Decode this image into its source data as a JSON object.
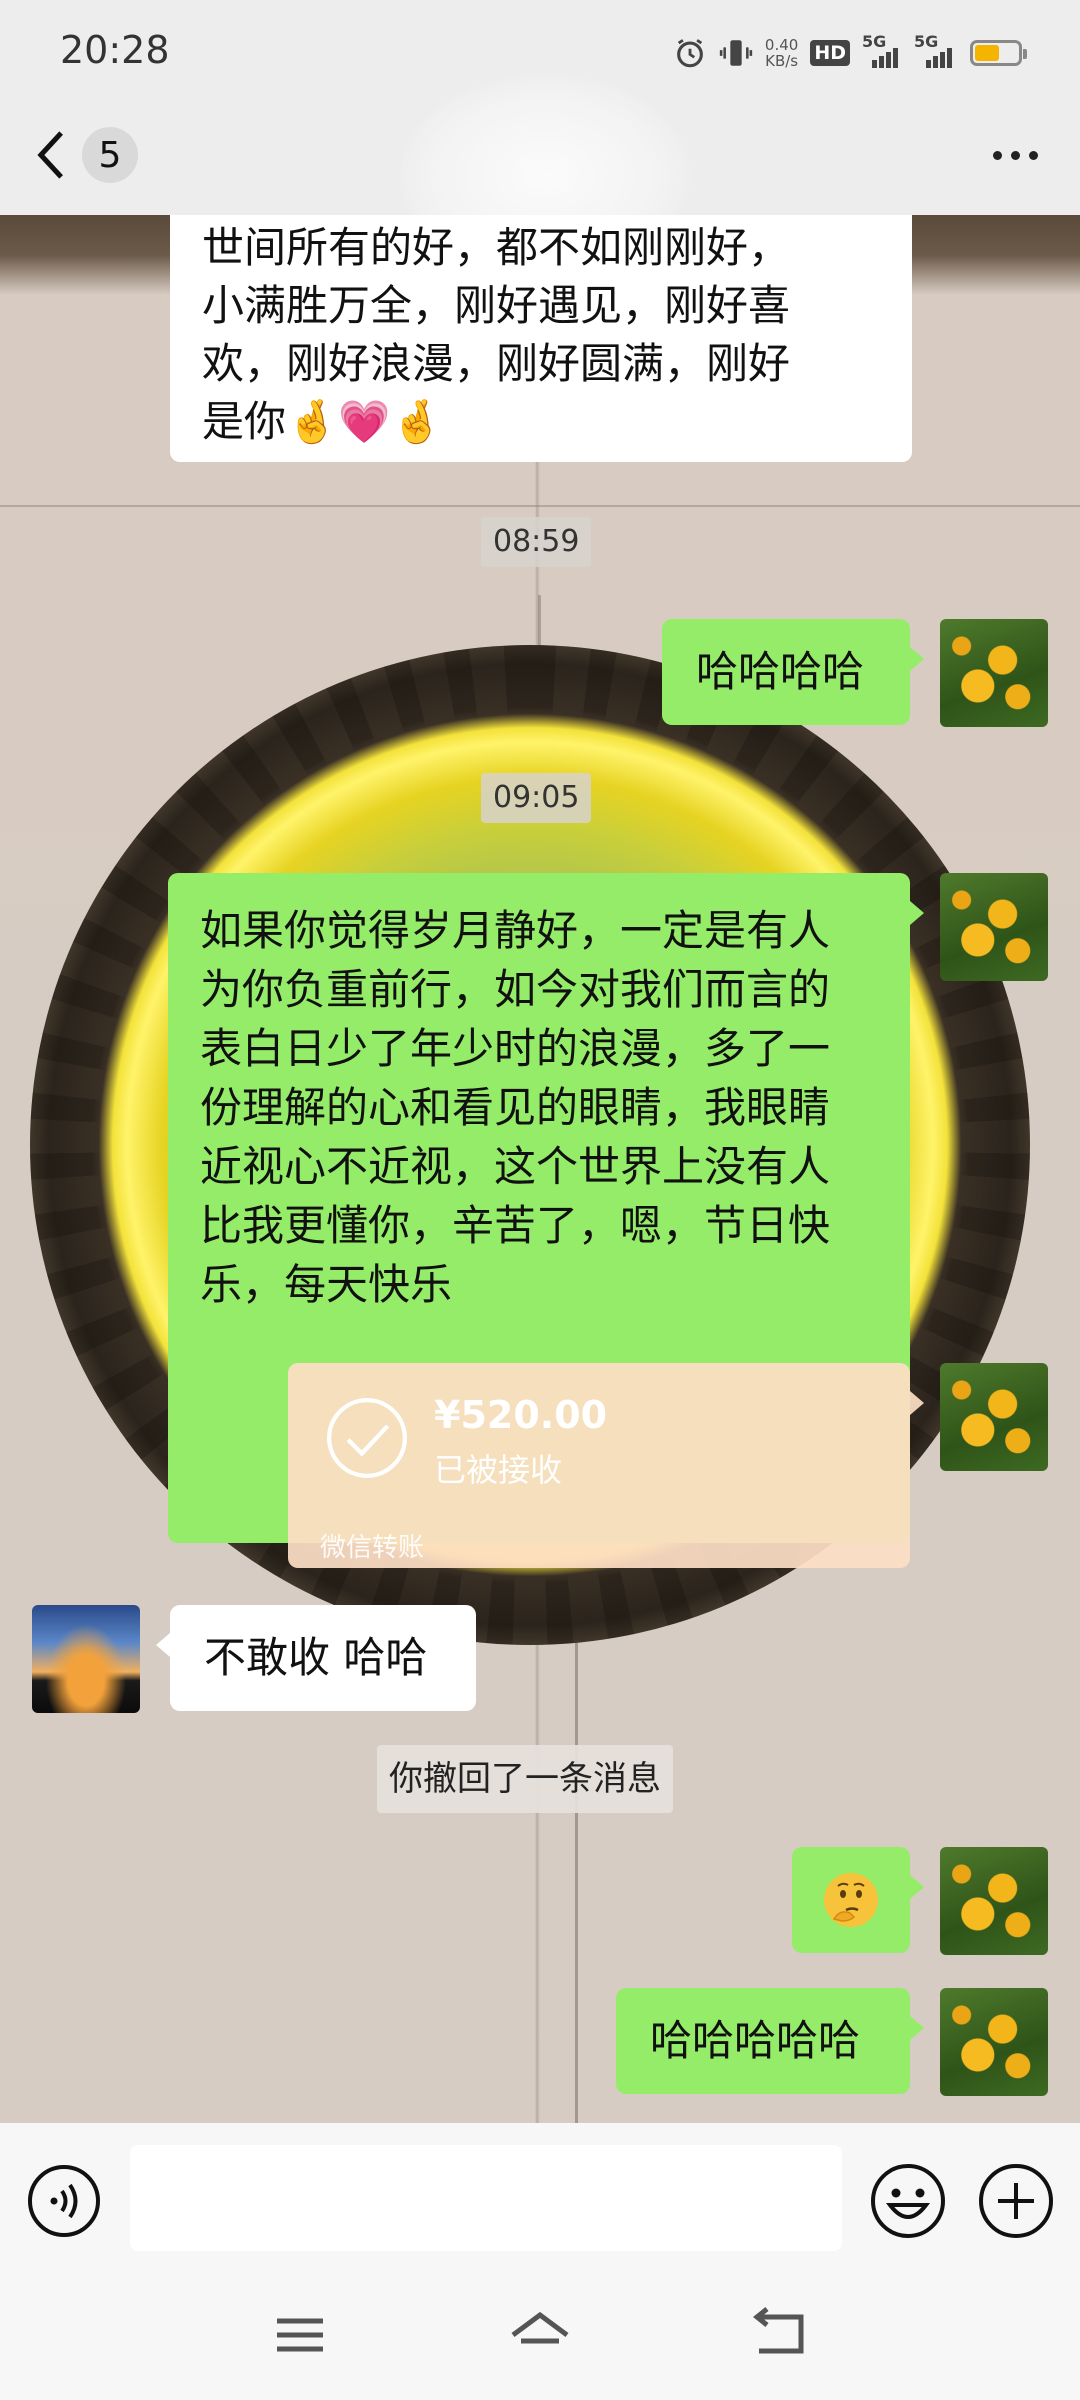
{
  "status_bar": {
    "time": "20:28",
    "net_speed": "0.40",
    "net_unit": "KB/s",
    "hd_label": "HD",
    "sim1_label": "5G",
    "sim2_label": "5G",
    "battery_level": 0.58,
    "battery_color": "#f5b400"
  },
  "nav": {
    "back_icon": "chevron-left-icon",
    "unread_count": "5",
    "more_icon": "more-dots-icon"
  },
  "messages": {
    "m1_text_lines": [
      "世间所有的好，都不如刚刚好，",
      "小满胜万全，刚好遇见，刚好喜",
      "欢，刚好浪漫，刚好圆满，刚好",
      "是你"
    ],
    "m1_emoji": "🤞💗🤞",
    "time1": "08:59",
    "m2_text": "哈哈哈哈",
    "time2": "09:05",
    "m3_text_lines": [
      "如果你觉得岁月静好，一定是有人",
      "为你负重前行，如今对我们而言的",
      "表白日少了年少时的浪漫，多了一",
      "份理解的心和看见的眼睛，我眼睛",
      "近视心不近视，这个世界上没有人",
      "比我更懂你，辛苦了，嗯，节日快",
      "乐，每天快乐"
    ],
    "transfer": {
      "amount": "¥520.00",
      "status": "已被接收",
      "footer": "微信转账",
      "check_icon": "check-circle-icon"
    },
    "m5_text": "不敢收 哈哈",
    "recall_notice": "你撤回了一条消息",
    "m6_emoji_name": "thinking-face-emoji",
    "m7_text": "哈哈哈哈哈"
  },
  "colors": {
    "bubble_out": "#95ec69",
    "bubble_in": "#ffffff",
    "transfer_bg": "#fcdec4"
  },
  "input_bar": {
    "value": "",
    "voice_icon": "voice-icon",
    "emoji_icon": "emoji-icon",
    "plus_icon": "plus-icon"
  },
  "system_nav": {
    "menu_icon": "menu-icon",
    "home_icon": "home-icon",
    "back_icon": "back-icon"
  }
}
